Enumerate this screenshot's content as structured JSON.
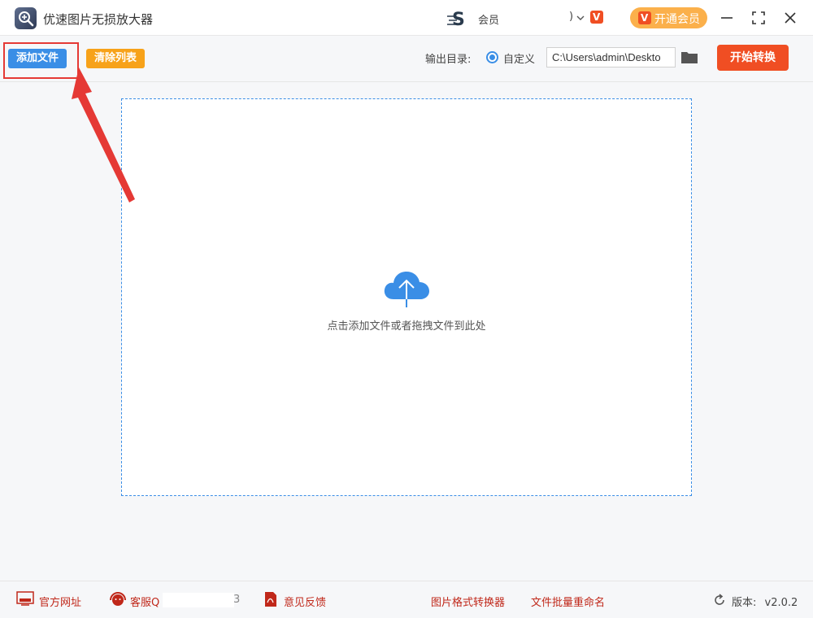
{
  "window": {
    "title": "优速图片无损放大器",
    "user_name": "会员",
    "user_paren": ")",
    "vip_badge": "V",
    "vip_button_label": "开通会员"
  },
  "toolbar": {
    "add_file_label": "添加文件",
    "clear_list_label": "清除列表",
    "output_dir_label": "输出目录:",
    "custom_option_label": "自定义",
    "output_path": "C:\\Users\\admin\\Deskto",
    "start_label": "开始转换"
  },
  "dropzone": {
    "hint": "点击添加文件或者拖拽文件到此处"
  },
  "footer": {
    "website_label": "官方网址",
    "support_label": "客服Q",
    "support_tail": "3",
    "feedback_label": "意见反馈",
    "converter_label": "图片格式转换器",
    "rename_label": "文件批量重命名",
    "version_label": "版本:",
    "version_value": "v2.0.2"
  },
  "colors": {
    "primary": "#3a8ee6",
    "orange": "#f7a21a",
    "red": "#f04e23",
    "vip": "#fbb04b",
    "annotation": "#e53935"
  }
}
